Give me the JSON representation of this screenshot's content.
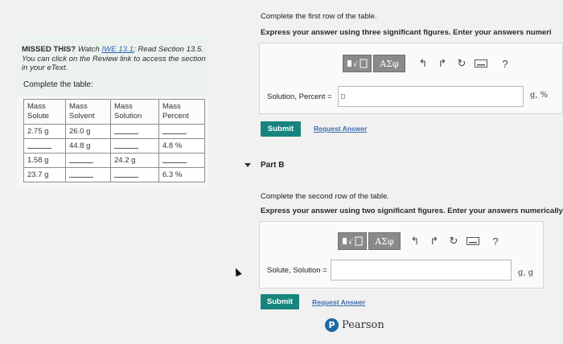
{
  "missed": {
    "prefix": "MISSED THIS?",
    "watch": " Watch ",
    "link": "IWE 13.1",
    "rest": "; Read Section 13.5. You can click on the Review link to access the section in your eText."
  },
  "instructions": {
    "complete_table": "Complete the table:"
  },
  "table": {
    "headers": [
      "Mass\nSolute",
      "Mass\nSolvent",
      "Mass\nSolution",
      "Mass\nPercent"
    ],
    "rows": [
      [
        "2.75 g",
        "26.0 g",
        "",
        ""
      ],
      [
        "",
        "44.8 g",
        "",
        "4.8 %"
      ],
      [
        "1.58 g",
        "",
        "24.2 g",
        ""
      ],
      [
        "23.7 g",
        "",
        "",
        "6.3 %"
      ]
    ]
  },
  "part_a": {
    "prompt": "Complete the first row of the table.",
    "instruction": "Express your answer using three significant figures. Enter your answers numeri",
    "answer_label": "Solution, Percent =",
    "units": "g, %",
    "submit": "Submit",
    "request": "Request Answer"
  },
  "part_b": {
    "title": "Part B",
    "prompt": "Complete the second row of the table.",
    "instruction": "Express your answer using two significant figures. Enter your answers numerically",
    "answer_label": "Solute, Solution =",
    "units": "g, g",
    "submit": "Submit",
    "request": "Request Answer"
  },
  "toolbar": {
    "templates_icon": "templates-icon",
    "greek_label": "ΑΣφ",
    "undo_icon": "undo-icon",
    "redo_icon": "redo-icon",
    "reset_icon": "reset-icon",
    "keyboard_icon": "keyboard-icon",
    "help_label": "?"
  },
  "brand": {
    "name": "Pearson",
    "logo_letter": "P"
  }
}
